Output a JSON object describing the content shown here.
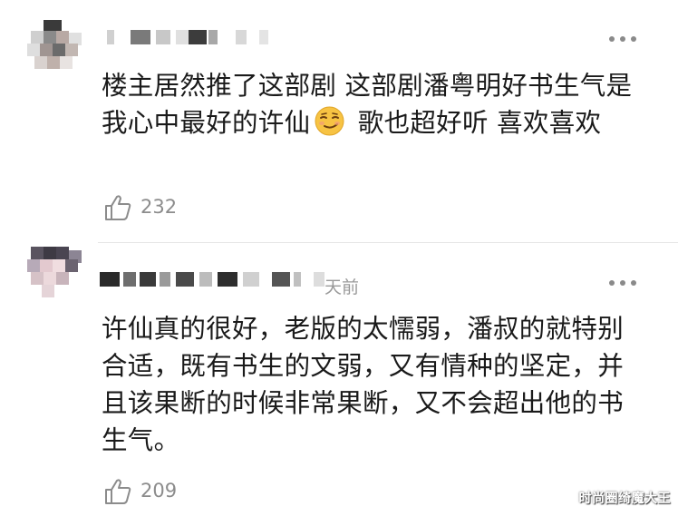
{
  "comments": [
    {
      "text": "楼主居然推了这部剧 这部剧潘粤明好书生气是我心中最好的许仙",
      "text_after_emoji": " 歌也超好听 喜欢喜欢",
      "emoji": "smirk-emoji",
      "like_count": "232"
    },
    {
      "time_suffix": "天前",
      "text": "许仙真的很好，老版的太懦弱，潘叔的就特别合适，既有书生的文弱，又有情种的坚定，并且该果断的时候非常果断，又不会超出他的书生气。",
      "like_count": "209"
    }
  ],
  "watermark": "时尚圈绮魔大王",
  "colors": {
    "text": "#1a1a1a",
    "meta": "#999999",
    "divider": "#e6e6e6",
    "emoji_face": "#f7c343"
  }
}
